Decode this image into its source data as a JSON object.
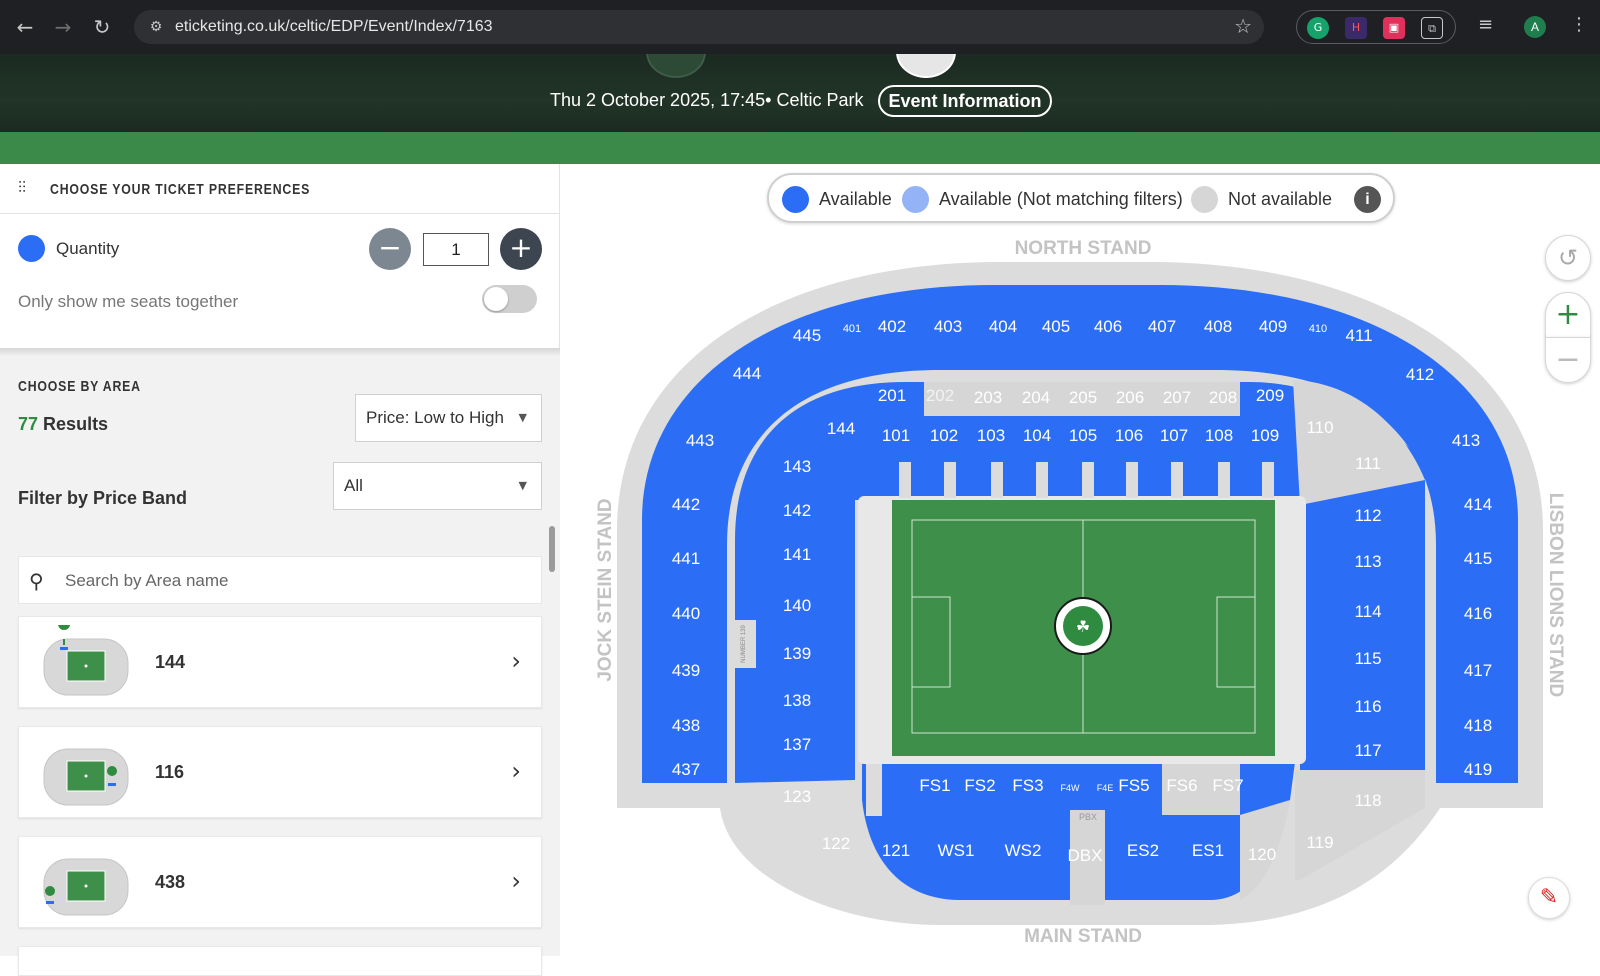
{
  "browser": {
    "url": "eticketing.co.uk/celtic/EDP/Event/Index/7163",
    "avatar_letter": "A",
    "extensions": [
      "grammarly-icon",
      "honey-icon",
      "clipper-icon",
      "puzzle-icon"
    ]
  },
  "event": {
    "date_venue": "Thu 2 October 2025, 17:45• Celtic Park",
    "info_button": "Event Information"
  },
  "preferences": {
    "title": "CHOOSE YOUR TICKET PREFERENCES",
    "quantity_label": "Quantity",
    "quantity_value": "1",
    "together_label": "Only show me seats together",
    "together_on": false
  },
  "area": {
    "title": "CHOOSE BY AREA",
    "results_count": "77",
    "results_label": "Results",
    "sort_value": "Price: Low to High",
    "price_band_label": "Filter by Price Band",
    "price_band_value": "All",
    "search_placeholder": "Search by Area name",
    "cards": [
      {
        "label": "144"
      },
      {
        "label": "116"
      },
      {
        "label": "438"
      }
    ]
  },
  "legend": {
    "available": "Available",
    "available_nomatch": "Available (Not matching filters)",
    "not_available": "Not available",
    "info": "i"
  },
  "colors": {
    "available": "#2b6ef5",
    "available_nomatch": "#93b3f6",
    "not_available": "#d6d6d6",
    "brand_green": "#3b8a4a",
    "pitch": "#3e8f49"
  },
  "map": {
    "stands": {
      "north": "NORTH STAND",
      "main": "MAIN STAND",
      "west": "JOCK STEIN STAND",
      "east": "LISBON LIONS STAND"
    },
    "number_label": "NUMBER 139"
  }
}
